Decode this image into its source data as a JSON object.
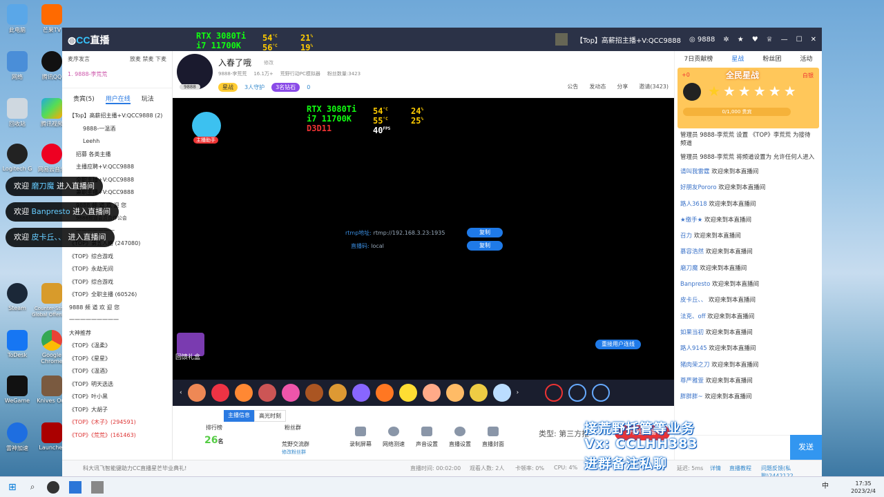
{
  "desktop": {
    "icons": [
      "此电脑",
      "芒果TV",
      "网络",
      "腾讯QQ",
      "回收站",
      "腾讯视频",
      "Logitech G",
      "网易云音乐",
      "Steam",
      "Counter-Strike Global Offensive",
      "ToDesk",
      "Google Chrome",
      "WeGame",
      "Knives Out",
      "雷神加速",
      "Launcher"
    ]
  },
  "window": {
    "title": "【Top】高薪招主播+V:QCC9888",
    "room_id": "9888",
    "logo_cc": "CC",
    "logo_text": "直播"
  },
  "hw": {
    "gpu": "RTX 3080Ti",
    "cpu": "i7 11700K",
    "api": "D3D11",
    "gpu_temp": "54",
    "gpu_load": "21",
    "cpu_temp": "56",
    "cpu_load": "19",
    "fps": "7",
    "gpu_temp_v": "54",
    "gpu_load_v": "24",
    "cpu_temp_v": "55",
    "cpu_load_v": "25",
    "fps_v": "40",
    "unit_c": "°C",
    "unit_p": "%",
    "unit_fps": "FPS"
  },
  "left": {
    "mic": "麦序发言",
    "mic_opts": "放麦 禁麦 下麦",
    "first": "1. 9888-李荒荒",
    "tabs": [
      "贵宾(5)",
      "用户在线",
      "玩法"
    ],
    "channels": [
      "【Top】高薪招主播+V:QCC9888 (2)",
      "9888-一温酒",
      "Leehh",
      "招募 各类主播",
      "主播应聘+V:QCC9888",
      "全职主播+V:QCC9888",
      "兼职主播+V:QCC9888",
      "9888 频 道 欢 迎 您",
      "9888频道会员合作公会",
      "一一一一一一一",
      "《TOP》第五人格 (247080)",
      "《TOP》综合游戏",
      "《TOP》永劫无间",
      "《TOP》综合游戏",
      "《TOP》全职主播 (60526)",
      "9888 频 道 欢 迎 您",
      "一一一一一一一一一",
      "大神推荐",
      "《TOP》《温柔》",
      "《TOP》《星星》",
      "《TOP》《温酒》",
      "《TOP》明天选选",
      "《TOP》叶小黑",
      "《TOP》大胡子",
      "《TOP》《木子》(294591)",
      "《TOP》《荒荒》(161463)"
    ]
  },
  "toasts": [
    {
      "pre": "欢迎 ",
      "name": "磨刀魔",
      "post": " 进入直播间"
    },
    {
      "pre": "欢迎 ",
      "name": "Banpresto",
      "post": " 进入直播间"
    },
    {
      "pre": "欢迎 ",
      "name": "皮卡丘、、",
      "post": " 进入直播间"
    }
  ],
  "header": {
    "name": "入春了哦",
    "edit": "修改",
    "id": "9888-李荒荒",
    "fans": "16.1万+",
    "game": "荒野行动PC模拟器",
    "fan_count": "粉丝数量:3423",
    "badge": "9888",
    "star": "星战",
    "guard": "3人守护",
    "diamond": "3名钻石",
    "zero": "0",
    "notice": "公告",
    "dyn": "发动态",
    "share": "分享",
    "invite": "邀请(3423)"
  },
  "video": {
    "helper": "主播助手",
    "rtmp_label": "rtmp地址:",
    "rtmp": "rtmp://192.168.3.23:1935",
    "key_label": "直播码:",
    "key": "local",
    "copy": "复制",
    "gift_box": "回馈礼盒",
    "online_btn": "重接用户连线"
  },
  "controls": {
    "tabs": [
      "主播信息",
      "高光时刻"
    ],
    "rank": "排行榜",
    "rank_count": "26",
    "rank_unit": "名",
    "fans_group": "粉丝群",
    "group_name": "荒野交流群",
    "group_sub": "修改粉丝群",
    "buttons": [
      "录制屏幕",
      "网络测速",
      "声音设置",
      "直播设置",
      "直播封面"
    ],
    "type": "类型: 第三方推",
    "start": "开始直播"
  },
  "status": {
    "ticker": "科大讯飞智能键助力CC直播星芒毕业典礼!",
    "live_time": "直播时间: 00:02:00",
    "viewers": "观看人数: 2人",
    "lag": "卡顿率: 0%",
    "cpu": "CPU: 4%",
    "delay": "延迟: 5ms",
    "detail": "详情",
    "tutorial": "直播教程",
    "feedback": "问题反馈(私聊)2442122"
  },
  "right": {
    "tabs": [
      "7日贡献榜",
      "星战",
      "粉丝团",
      "活动"
    ],
    "star_title": "全民星战",
    "plus": "+0",
    "white": "白银",
    "progress": "0/1,000 贵宾",
    "sys1": "管理员 9888-李荒荒 设置 《TOP》李荒荒 为接待频道",
    "sys2": "管理员 9888-李荒荒 将频道设置为 允许任何人进入",
    "messages": [
      [
        "请叫我雷霆",
        "欢迎来到本直播间"
      ],
      [
        "好朋友Pororo",
        "欢迎来到本直播间"
      ],
      [
        "路人3618",
        "欢迎来到本直播间"
      ],
      [
        "★缴手★",
        "欢迎来到本直播间"
      ],
      [
        "召力",
        "欢迎来到本直播间"
      ],
      [
        "慕容浩然",
        "欢迎来到本直播间"
      ],
      [
        "磨刀魔",
        "欢迎来到本直播间"
      ],
      [
        "Banpresto",
        "欢迎来到本直播间"
      ],
      [
        "皮卡丘、、",
        "欢迎来到本直播间"
      ],
      [
        "法克、off",
        "欢迎来到本直播间"
      ],
      [
        "如果当初",
        "欢迎来到本直播间"
      ],
      [
        "路人9145",
        "欢迎来到本直播间"
      ],
      [
        "猪肉荣之刀",
        "欢迎来到本直播间"
      ],
      [
        "尊严雅萱",
        "欢迎来到本直播间"
      ],
      [
        "胖胖胖~",
        "欢迎来到本直播间"
      ]
    ],
    "send": "发送"
  },
  "overlay": [
    "接荒野托管等业务",
    "Vx: CCLHH383",
    "进群备注私聊"
  ],
  "taskbar": {
    "time": "17:35",
    "date": "2023/2/4",
    "ime": "中"
  }
}
